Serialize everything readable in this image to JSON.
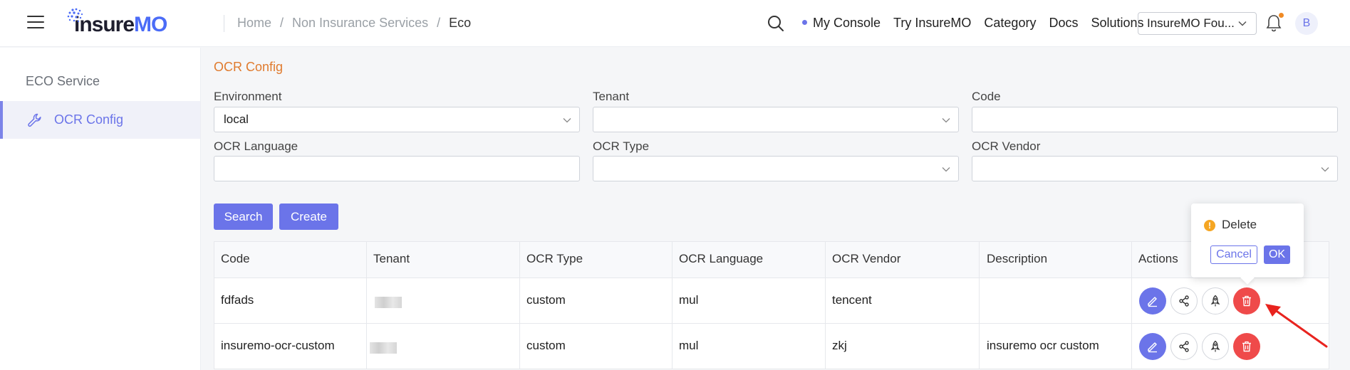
{
  "header": {
    "logo_text": "insure",
    "logo_text_accent": "MO",
    "breadcrumb": [
      "Home",
      "Non Insurance Services",
      "Eco"
    ],
    "nav": [
      "My Console",
      "Try InsureMO",
      "Category",
      "Docs",
      "Solutions"
    ],
    "org_select": "InsureMO Fou...",
    "avatar_initial": "B"
  },
  "sidebar": {
    "group": "ECO Service",
    "items": [
      {
        "label": "OCR Config",
        "icon": "wrench-icon",
        "active": true
      }
    ]
  },
  "main": {
    "title": "OCR Config",
    "fields": {
      "environment": {
        "label": "Environment",
        "value": "local"
      },
      "tenant": {
        "label": "Tenant",
        "value": ""
      },
      "code": {
        "label": "Code",
        "value": ""
      },
      "ocr_language": {
        "label": "OCR Language",
        "value": ""
      },
      "ocr_type": {
        "label": "OCR Type",
        "value": ""
      },
      "ocr_vendor": {
        "label": "OCR Vendor",
        "value": ""
      }
    },
    "buttons": {
      "search": "Search",
      "create": "Create"
    },
    "table": {
      "columns": [
        "Code",
        "Tenant",
        "OCR Type",
        "OCR Language",
        "OCR Vendor",
        "Description",
        "Actions"
      ],
      "rows": [
        {
          "code": "fdfads",
          "tenant": "",
          "ocr_type": "custom",
          "ocr_language": "mul",
          "ocr_vendor": "tencent",
          "description": ""
        },
        {
          "code": "insuremo-ocr-custom",
          "tenant": "",
          "ocr_type": "custom",
          "ocr_language": "mul",
          "ocr_vendor": "zkj",
          "description": "insuremo ocr custom"
        }
      ]
    }
  },
  "popconfirm": {
    "message": "Delete",
    "cancel": "Cancel",
    "ok": "OK"
  },
  "colors": {
    "accent": "#6b74e9",
    "title_orange": "#e07b2e",
    "danger": "#ef4a4a",
    "annotation_arrow": "#e8231e"
  }
}
